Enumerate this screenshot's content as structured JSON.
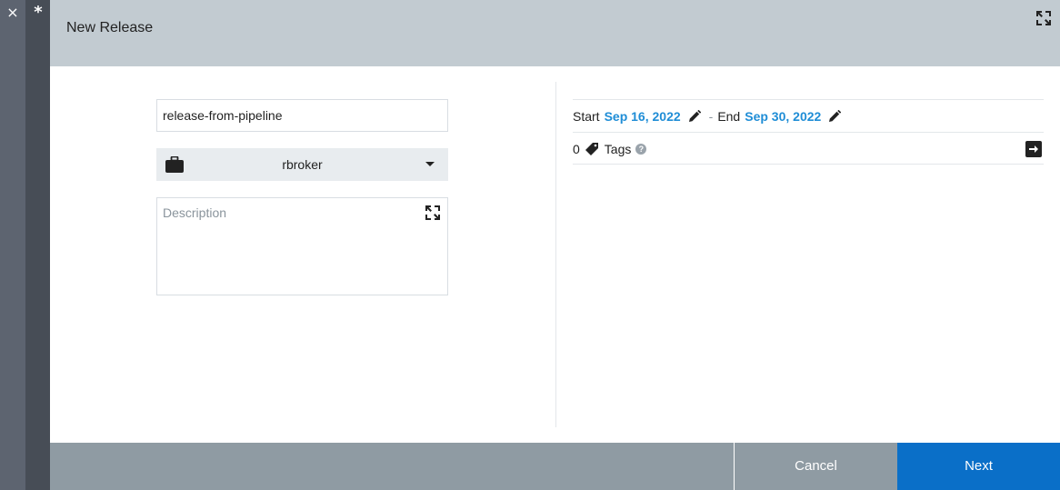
{
  "sidebar": {
    "close_glyph": "×",
    "star_glyph": "*"
  },
  "dialog": {
    "title": "New Release",
    "name_value": "release-from-pipeline",
    "project": "rbroker",
    "description_placeholder": "Description",
    "dates": {
      "start_label": "Start",
      "start_date": "Sep 16, 2022",
      "separator": "-",
      "end_label": "End",
      "end_date": "Sep 30, 2022"
    },
    "tags": {
      "count": "0",
      "label": "Tags",
      "help_glyph": "?"
    },
    "footer": {
      "cancel_label": "Cancel",
      "next_label": "Next"
    }
  },
  "colors": {
    "accent": "#1f8dd6",
    "primary_button": "#0a6fc8",
    "header_bg": "#c2cbd1",
    "footer_bg": "#8f9ba3"
  },
  "icons": {
    "close": "close-icon",
    "star": "star-icon",
    "expand": "expand-icon",
    "project": "briefcase-icon",
    "caret": "caret-down-icon",
    "edit": "pencil-icon",
    "tag": "tag-icon",
    "help": "help-icon",
    "tags_panel": "arrow-right-box-icon"
  }
}
